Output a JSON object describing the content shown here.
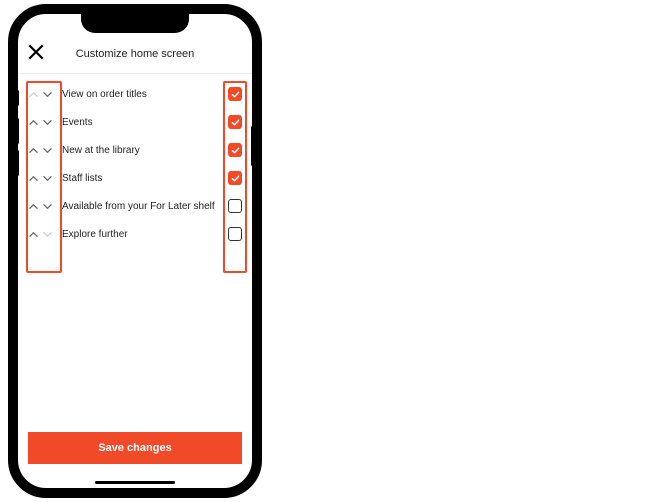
{
  "colors": {
    "accent": "#f14a29"
  },
  "header": {
    "title": "Customize home screen"
  },
  "items": [
    {
      "label": "View on order titles",
      "up": false,
      "down": true,
      "checked": true
    },
    {
      "label": "Events",
      "up": true,
      "down": true,
      "checked": true
    },
    {
      "label": "New at the library",
      "up": true,
      "down": true,
      "checked": true
    },
    {
      "label": "Staff lists",
      "up": true,
      "down": true,
      "checked": true
    },
    {
      "label": "Available from your For Later shelf",
      "up": true,
      "down": true,
      "checked": false
    },
    {
      "label": "Explore further",
      "up": true,
      "down": false,
      "checked": false
    }
  ],
  "footer": {
    "save_label": "Save changes"
  }
}
